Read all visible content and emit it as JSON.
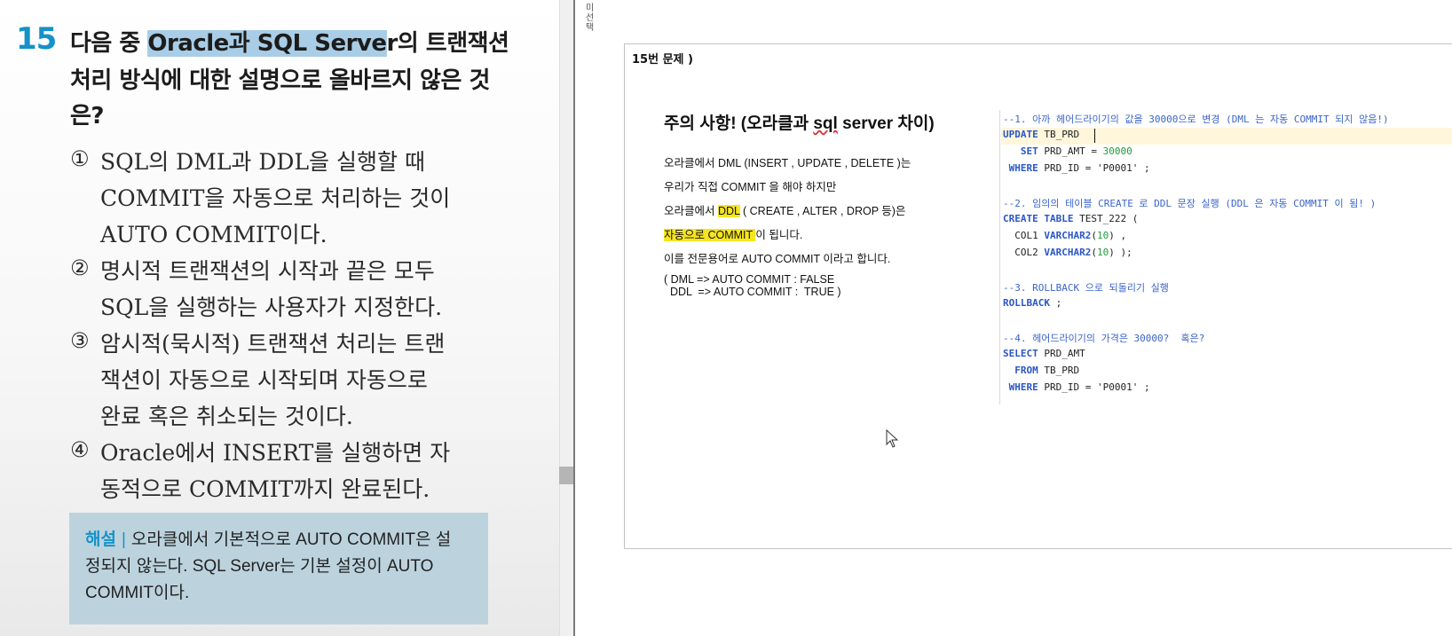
{
  "question": {
    "number": "15",
    "line1_pre": "다음 중 ",
    "line1_hl": "Oracle과 SQL Serve",
    "line1_post": "r의 트랜잭션",
    "line2": "처리 방식에 대한 설명으로 올바르지 않은 것",
    "line3": "은?"
  },
  "options": [
    {
      "no": "①",
      "lines": [
        "SQL의 DML과 DDL을 실행할 때",
        "COMMIT을 자동으로 처리하는 것이",
        "AUTO COMMIT이다."
      ]
    },
    {
      "no": "②",
      "lines": [
        "명시적 트랜잭션의 시작과 끝은 모두",
        "SQL을 실행하는 사용자가 지정한다."
      ]
    },
    {
      "no": "③",
      "lines": [
        "암시적(묵시적) 트랜잭션 처리는 트랜",
        "잭션이 자동으로 시작되며 자동으로",
        "완료 혹은 취소되는 것이다."
      ]
    },
    {
      "no": "④",
      "lines": [
        "Oracle에서 INSERT를 실행하면 자",
        "동적으로 COMMIT까지 완료된다."
      ]
    }
  ],
  "explanation": {
    "label": "해설",
    "separator": "|",
    "line1": "오라클에서 기본적으로 AUTO COMMIT은 설",
    "line2": "정되지 않는다. SQL Server는 기본 설정이 AUTO",
    "line3": "COMMIT이다."
  },
  "ruler_text": "미선택",
  "editor": {
    "page_label": "15번 문제 )",
    "notice_title_pre": "주의 사항! (오라클과 ",
    "notice_title_sql": "sql",
    "notice_title_post": " server 차이)",
    "n1": "오라클에서 DML (INSERT , UPDATE , DELETE )는",
    "n2": "우리가 직접 COMMIT 을 해야 하지만",
    "n3_pre": "오라클에서 ",
    "n3_hl": "DDL",
    "n3_post": " ( CREATE , ALTER , DROP 등)은",
    "n4_hl": "자동으로 COMMIT ",
    "n4_post": "이 됩니다.",
    "n5": "이를 전문용어로 AUTO COMMIT 이라고 합니다.",
    "n6": "( DML => AUTO COMMIT : FALSE",
    "n7": "  DDL  => AUTO COMMIT :  TRUE )"
  },
  "code": {
    "c1": "--1. 아까 헤어드라이기의 값을 30000으로 변경 (DML 는 자동 COMMIT 되지 않음!)",
    "l2_kw": "UPDATE",
    "l2_rest": " TB_PRD",
    "l3_kw": "   SET",
    "l3_rest": " PRD_AMT = ",
    "l3_num": "30000",
    "l4_kw": " WHERE",
    "l4_rest": " PRD_ID = 'P0001' ;",
    "c2": "--2. 임의의 테이블 CREATE 로 DDL 문장 실행 (DDL 은 자동 COMMIT 이 됨! )",
    "l6_kw": "CREATE TABLE",
    "l6_rest": " TEST_222 (",
    "l7_pre": "  COL1 ",
    "l7_kw": "VARCHAR2",
    "l7_open": "(",
    "l7_num": "10",
    "l7_close": ") ,",
    "l8_pre": "  COL2 ",
    "l8_kw": "VARCHAR2",
    "l8_open": "(",
    "l8_num": "10",
    "l8_close": ") );",
    "c3": "--3. ROLLBACK 으로 되돌리기 실행",
    "l10_kw": "ROLLBACK",
    "l10_rest": " ;",
    "c4": "--4. 헤어드라이기의 가격은 30000?  혹은?",
    "l12_kw": "SELECT",
    "l12_rest": " PRD_AMT",
    "l13_kw": "  FROM",
    "l13_rest": " TB_PRD",
    "l14_kw": " WHERE",
    "l14_rest": " PRD_ID = 'P0001' ;"
  }
}
